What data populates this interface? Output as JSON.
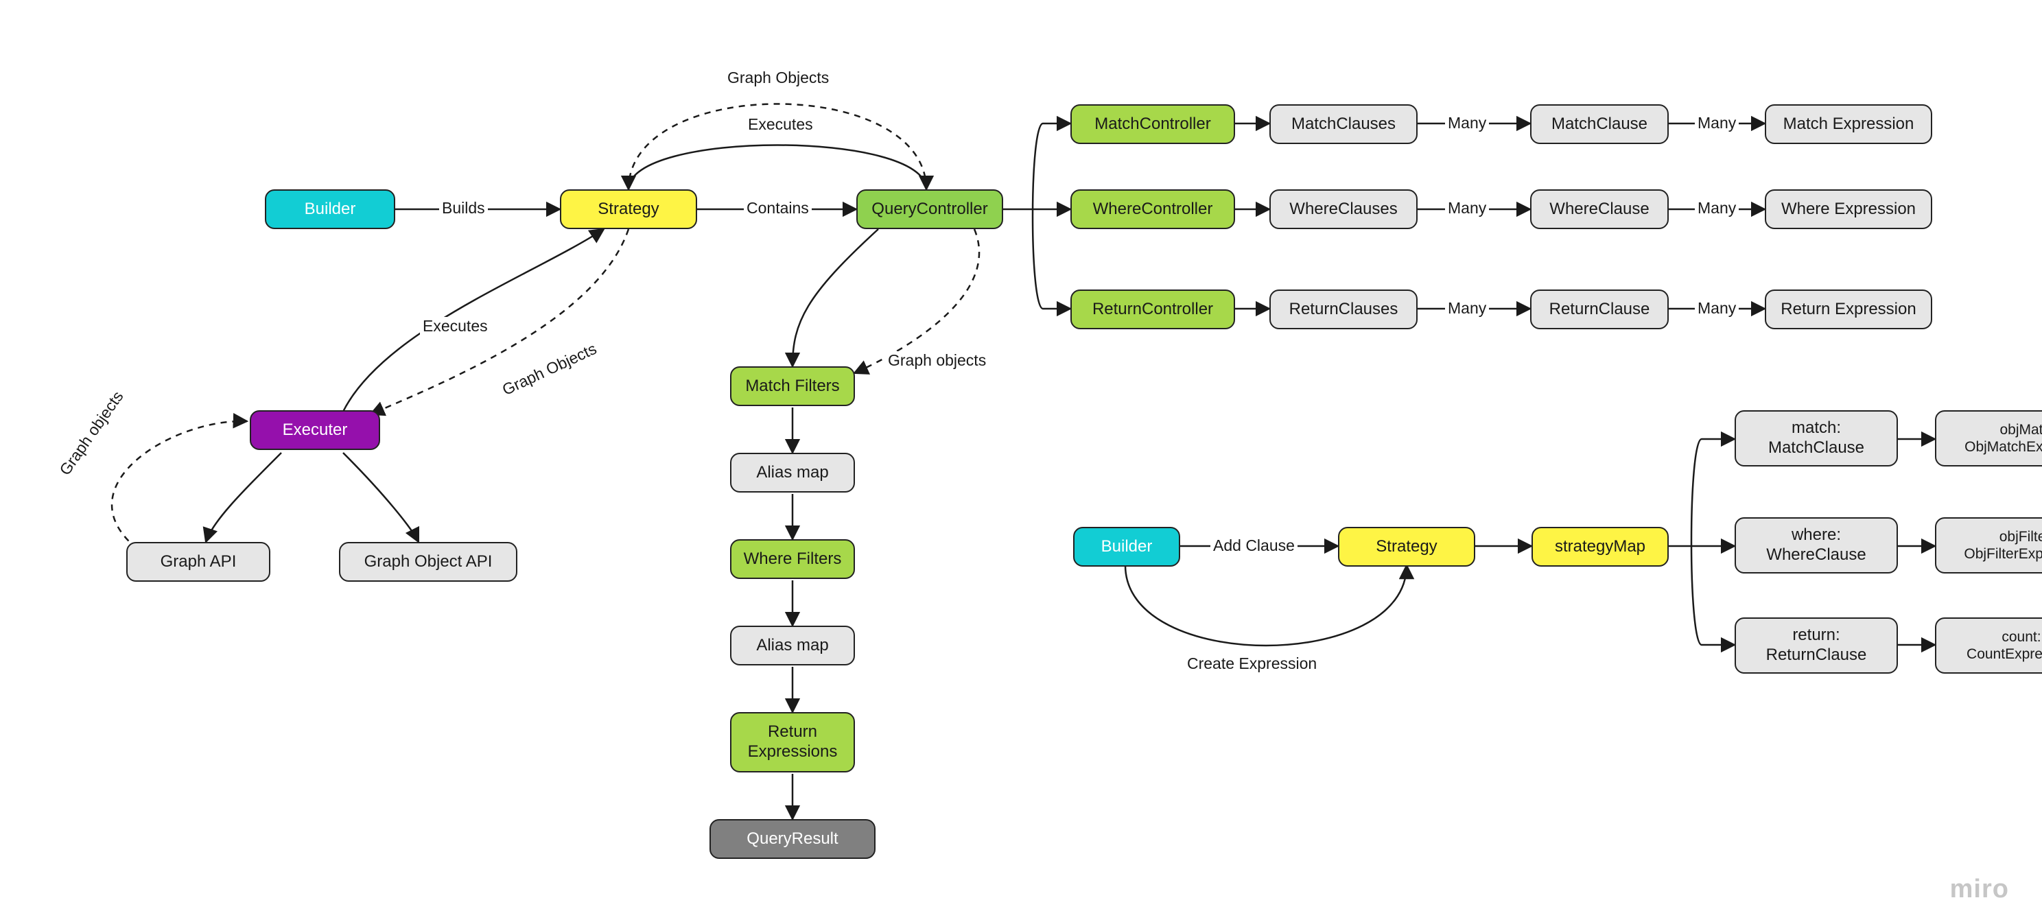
{
  "watermark": "miro",
  "nodes": {
    "builder": {
      "label": "Builder"
    },
    "strategy": {
      "label": "Strategy"
    },
    "queryController": {
      "label": "QueryController"
    },
    "executer": {
      "label": "Executer"
    },
    "graphApi": {
      "label": "Graph API"
    },
    "graphObjectApi": {
      "label": "Graph Object API"
    },
    "matchController": {
      "label": "MatchController"
    },
    "whereController": {
      "label": "WhereController"
    },
    "returnController": {
      "label": "ReturnController"
    },
    "matchClauses": {
      "label": "MatchClauses"
    },
    "whereClauses": {
      "label": "WhereClauses"
    },
    "returnClauses": {
      "label": "ReturnClauses"
    },
    "matchClause": {
      "label": "MatchClause"
    },
    "whereClause": {
      "label": "WhereClause"
    },
    "returnClause": {
      "label": "ReturnClause"
    },
    "matchExpression": {
      "label": "Match Expression"
    },
    "whereExpression": {
      "label": "Where Expression"
    },
    "returnExpression": {
      "label": "Return Expression"
    },
    "matchFilters": {
      "label": "Match Filters"
    },
    "aliasMap1": {
      "label": "Alias map"
    },
    "whereFilters": {
      "label": "Where Filters"
    },
    "aliasMap2": {
      "label": "Alias map"
    },
    "returnExprs": {
      "label": "Return\nExpressions"
    },
    "queryResult": {
      "label": "QueryResult"
    },
    "builder2": {
      "label": "Builder"
    },
    "strategy2": {
      "label": "Strategy"
    },
    "strategyMap": {
      "label": "strategyMap"
    },
    "mapMatch": {
      "label": "match:\nMatchClause"
    },
    "mapWhere": {
      "label": "where:\nWhereClause"
    },
    "mapReturn": {
      "label": "return:\nReturnClause"
    },
    "objMatch": {
      "label": "objMatch:\nObjMatchExpression"
    },
    "objFilter": {
      "label": "objFilter:\nObjFilterExpression"
    },
    "countExpr": {
      "label": "count:\nCountExpression"
    }
  },
  "edgeLabels": {
    "builds": "Builds",
    "contains": "Contains",
    "executesTop": "Executes",
    "executesLeft": "Executes",
    "graphObjectsTop": "Graph Objects",
    "graphObjectsMid": "Graph Objects",
    "graphObjectsRight": "Graph objects",
    "graphObjectsLow": "Graph objects",
    "many1": "Many",
    "many2": "Many",
    "many3": "Many",
    "many4": "Many",
    "many5": "Many",
    "many6": "Many",
    "addClause": "Add Clause",
    "createExpr": "Create Expression"
  }
}
